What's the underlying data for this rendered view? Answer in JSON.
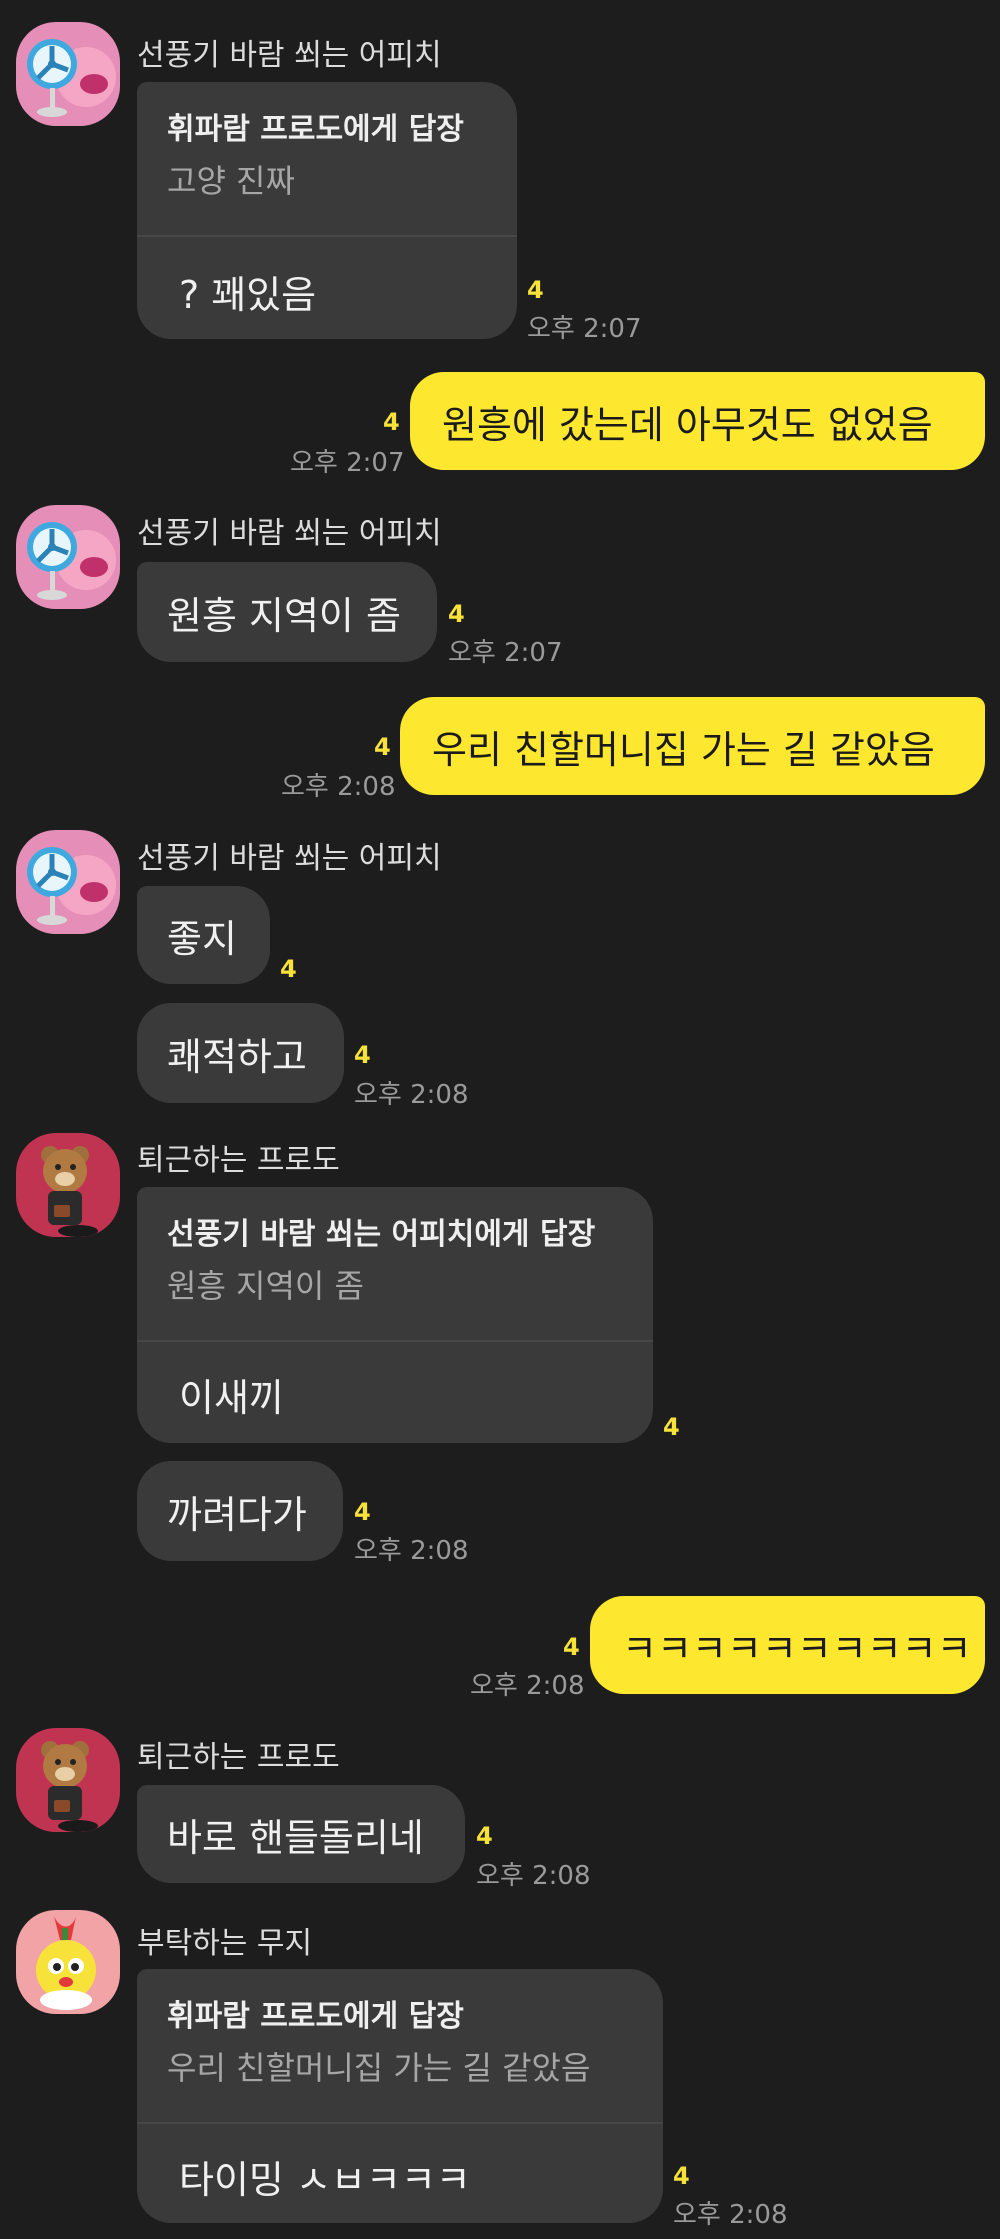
{
  "colors": {
    "background": "#1d1d1d",
    "incoming_bubble": "#3a3a3a",
    "outgoing_bubble": "#fde82f",
    "unread": "#f7e23a"
  },
  "users": {
    "apeach": {
      "name": "선풍기 바람 쐬는 어피치",
      "avatar": "apeach-fan-avatar"
    },
    "frodo": {
      "name": "퇴근하는 프로도",
      "avatar": "frodo-avatar"
    },
    "muzi": {
      "name": "부탁하는 무지",
      "avatar": "muzi-avatar"
    }
  },
  "messages": {
    "m1": {
      "reply_to": "휘파람 프로도에게 답장",
      "quoted": "고양 진짜",
      "text": "? 꽤있음",
      "unread": "4",
      "time": "오후 2:07"
    },
    "m2": {
      "text": "원흥에 갔는데 아무것도 없었음",
      "unread": "4",
      "time": "오후 2:07"
    },
    "m3": {
      "text": "원흥 지역이 좀",
      "unread": "4",
      "time": "오후 2:07"
    },
    "m4": {
      "text": "우리 친할머니집 가는 길 같았음",
      "unread": "4",
      "time": "오후 2:08"
    },
    "m5": {
      "text": "좋지",
      "unread": "4"
    },
    "m6": {
      "text": "쾌적하고",
      "unread": "4",
      "time": "오후 2:08"
    },
    "m7": {
      "reply_to": "선풍기 바람 쐬는 어피치에게 답장",
      "quoted": "원흥 지역이 좀",
      "text": "이새끼",
      "unread": "4"
    },
    "m8": {
      "text": "까려다가",
      "unread": "4",
      "time": "오후 2:08"
    },
    "m9": {
      "text": "ㅋㅋㅋㅋㅋㅋㅋㅋㅋㅋ",
      "unread": "4",
      "time": "오후 2:08"
    },
    "m10": {
      "text": "바로 핸들돌리네",
      "unread": "4",
      "time": "오후 2:08"
    },
    "m11": {
      "reply_to": "휘파람 프로도에게 답장",
      "quoted": "우리 친할머니집 가는 길 같았음",
      "text": "타이밍 ㅅㅂㅋㅋㅋ",
      "unread": "4",
      "time": "오후 2:08"
    }
  }
}
